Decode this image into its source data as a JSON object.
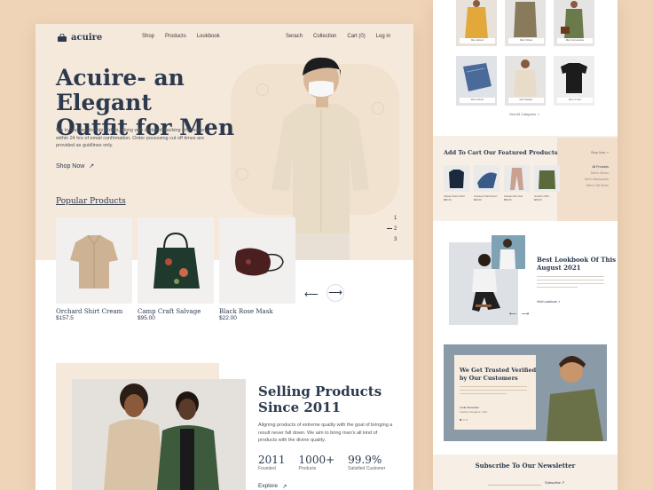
{
  "brand": {
    "name": "acuire"
  },
  "nav": {
    "left": [
      "Shop",
      "Products",
      "Lookbook"
    ],
    "right": [
      "Serach",
      "Collection",
      "Cart (0)",
      "Log in"
    ]
  },
  "hero": {
    "title_line1": "Acuire- an Elegant",
    "title_line2": "Outfit for Men",
    "body": "We try our bes to ship orders, along with updated tracking information, within 24 hrs of email confirmation. Order pocessing cut off times are provided as guidlines only.",
    "cta": "Shop Now",
    "pager": [
      "1",
      "2",
      "3"
    ]
  },
  "popular": {
    "heading": "Popular Products",
    "items": [
      {
        "name": "Orchard Shirt Cream",
        "price": "$157.5"
      },
      {
        "name": "Camp Craft Salvage",
        "price": "$95.00"
      },
      {
        "name": "Black Rose Mask",
        "price": "$22.00"
      }
    ]
  },
  "selling": {
    "title_line1": "Selling Products",
    "title_line2": "Since 2011",
    "body": "Aligning products of extreme quality with the goal of bringing a result never fall down. We aim to bring man's all kind of products with the divine quality.",
    "stats": [
      {
        "value": "2011",
        "label": "Founded"
      },
      {
        "value": "1000+",
        "label": "Products"
      },
      {
        "value": "99.9%",
        "label": "Satisfied Customer"
      }
    ],
    "cta": "Explore"
  },
  "side": {
    "categories": [
      "Men Jackets",
      "Men's Shoes",
      "Men's Accessories",
      "Men's Denim",
      "Men Sweater",
      "Men's T-shirt"
    ],
    "view_all": "View All Categories",
    "featured_title": "Add To Cart Our Featured Products",
    "shop_now": "Shop Now",
    "featured_list": [
      "All Products",
      "Men's Shoes",
      "Men's Backpacks",
      "Men's Tall Shirts"
    ],
    "featured_items": [
      {
        "name": "Classic Dress Shirt",
        "price": "$95.00"
      },
      {
        "name": "Crescent Shirt Denim",
        "price": "$99.00"
      },
      {
        "name": "Casual Cam Suit",
        "price": "$55.00"
      },
      {
        "name": "Junction Shirt",
        "price": "$65.00"
      }
    ],
    "lookbook_title_1": "Best Lookbook Of This",
    "lookbook_title_2": "August 2021",
    "lookbook_cta": "Visit Lookbook",
    "trusted_1": "We Get Trusted Verified",
    "trusted_2": "by Our Customers",
    "trusted_name": "Leslie Alexander",
    "trusted_role": "Fashion Designer, USA",
    "newsletter": "Subscribe To Our Newsletter",
    "subscribe": "Subscribe"
  },
  "colors": {
    "bg": "#f0d4b8",
    "hero": "#f5e9dc",
    "navy": "#2b3a4f",
    "accent": "#c9a77f"
  }
}
